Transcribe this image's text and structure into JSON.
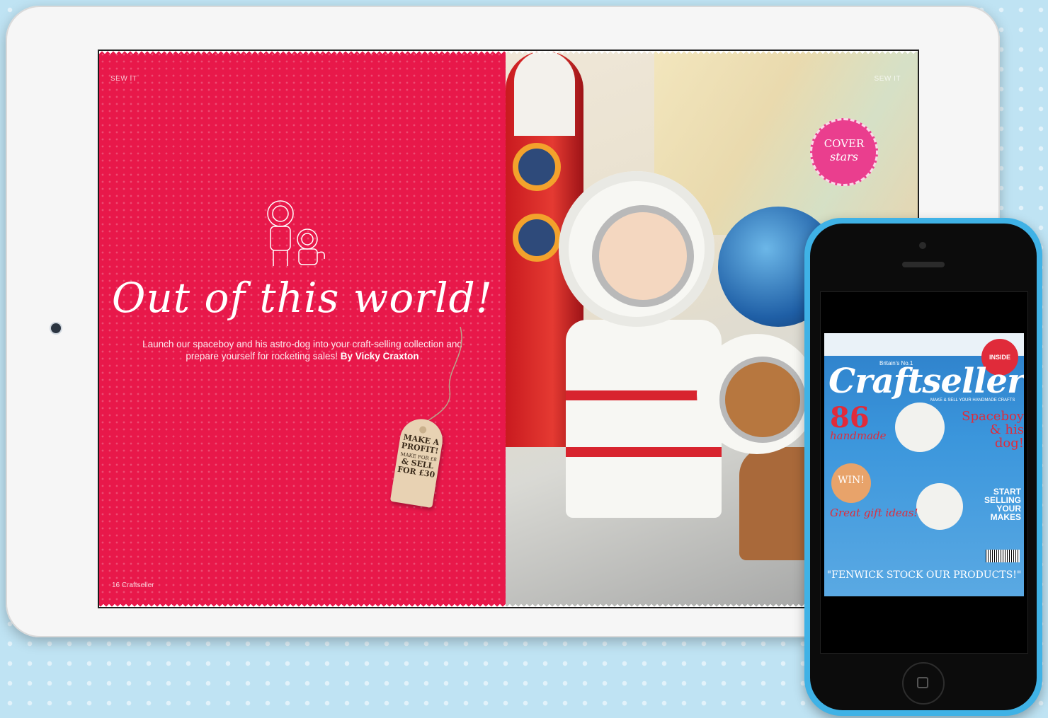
{
  "tablet": {
    "left_page": {
      "section_label": "SEW IT",
      "headline": "Out of this world!",
      "standfirst": "Launch our spaceboy and his astro-dog into your craft-selling collection and prepare yourself for rocketing sales!",
      "byline": "By Vicky Craxton",
      "folio": "16  Craftseller",
      "tag": {
        "line1": "MAKE A PROFIT!",
        "line2": "MAKE FOR £8",
        "line3": "& SELL FOR £30"
      }
    },
    "right_page": {
      "section_label": "SEW IT",
      "badge_line1": "COVER",
      "badge_line2": "stars"
    }
  },
  "phone": {
    "magazine": {
      "strapline": "Britain's No.1",
      "title": "Craftseller",
      "tagline": "MAKE & SELL YOUR HANDMADE CRAFTS",
      "count": "86",
      "count_label": "handmade",
      "feature": "Spaceboy & his dog!",
      "inside_badge": "INSIDE",
      "win": "WIN!",
      "gift": "Great gift ideas!",
      "start": "START SELLING YOUR MAKES",
      "quote": "\"FENWICK STOCK OUR PRODUCTS!\""
    }
  },
  "colors": {
    "page_red": "#e8184a",
    "background_blue": "#bfe3f3",
    "phone_blue": "#3fb2e6",
    "badge_pink": "#ea3e8e"
  }
}
